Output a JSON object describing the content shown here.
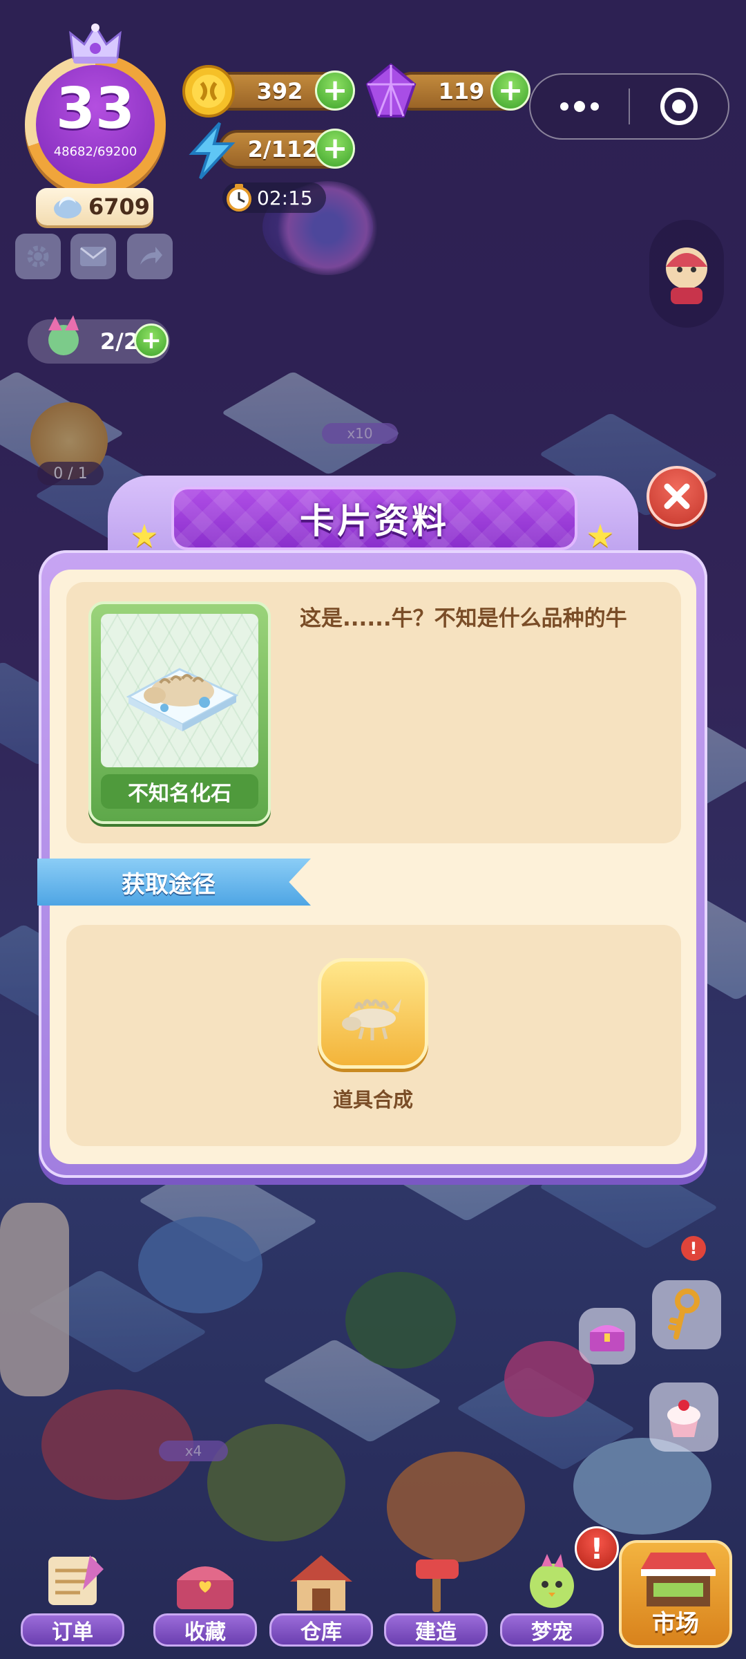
{
  "hud": {
    "level": "33",
    "xp": "48682/69200",
    "gems_secondary": "6709",
    "coins": "392",
    "diamonds": "119",
    "energy": "2/112",
    "timer": "02:15",
    "quest_progress": "2/2",
    "task_count": "0 / 1",
    "energy_bonus_a": "x10",
    "energy_bonus_b": "x4"
  },
  "dialog": {
    "title": "卡片资料",
    "card_name": "不知名化石",
    "description": "这是......牛？不知是什么品种的牛",
    "source_heading": "获取途径",
    "source_label": "道具合成"
  },
  "nav": {
    "orders": "订单",
    "collection": "收藏",
    "warehouse": "仓库",
    "build": "建造",
    "pets": "梦宠",
    "market": "市场"
  },
  "alert": "!",
  "colors": {
    "header_purple": "#8a2fcc",
    "dialog_cream": "#fdf1d9",
    "panel_tan": "#f6e2c0",
    "ribbon_blue": "#4ea5e4",
    "plus_green": "#3da32b",
    "close_red": "#c5362b"
  },
  "icons": [
    "crown-icon",
    "moon-gem-icon",
    "gear-icon",
    "mail-icon",
    "share-icon",
    "coin-icon",
    "diamond-icon",
    "lightning-icon",
    "clock-icon",
    "more-icon",
    "target-icon",
    "close-icon",
    "fossil-icon",
    "bone-icon",
    "star-icon"
  ]
}
